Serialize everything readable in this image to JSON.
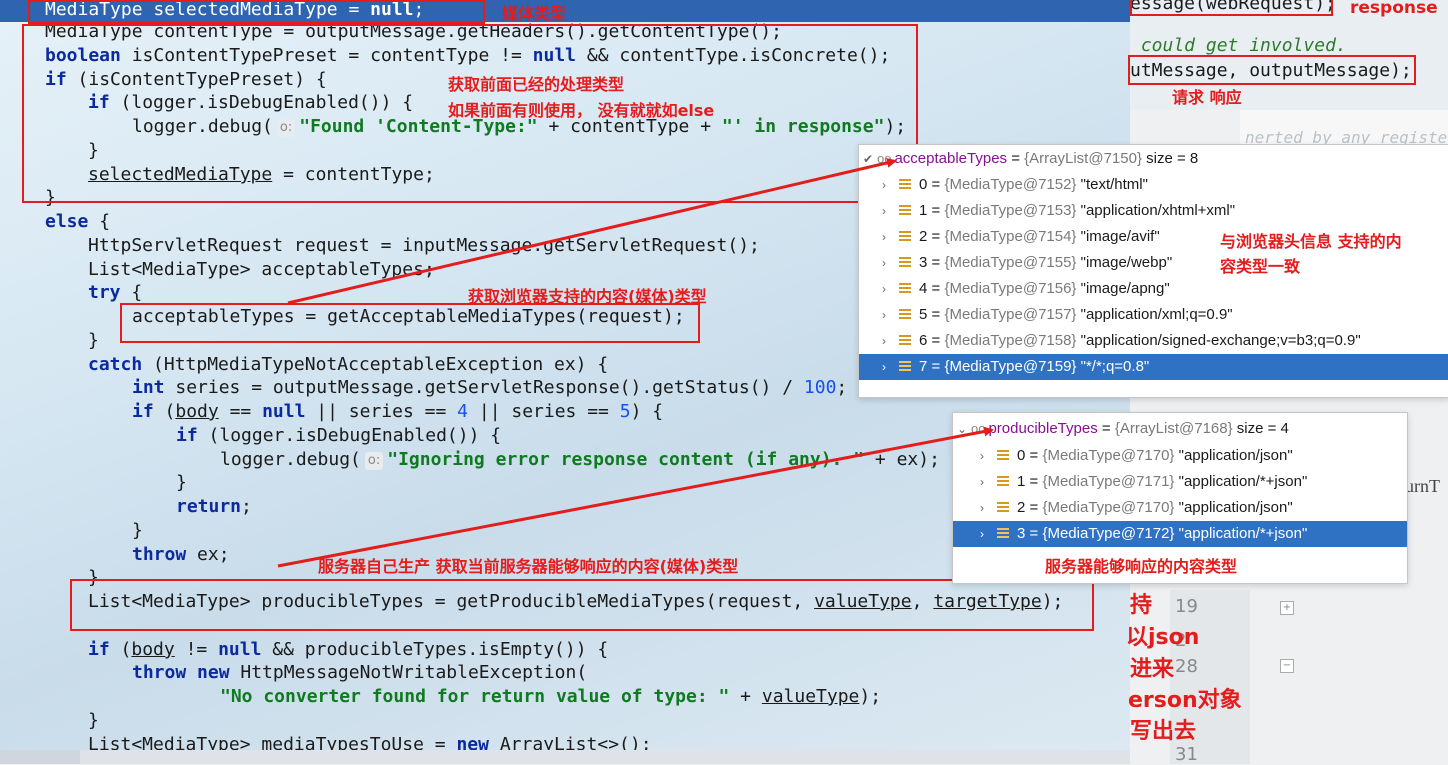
{
  "code": {
    "line1": {
      "t1": "MediaType",
      "t2": " selectedMediaType",
      "t3": " = ",
      "t4": "null",
      "t5": ";"
    },
    "line2": {
      "a": "MediaType contentType = outputMessage.getHeaders().getContentType();"
    },
    "line3": {
      "kw": "boolean",
      "rest": " isContentTypePreset = contentType != ",
      "kw2": "null",
      "rest2": " && contentType.isConcrete();"
    },
    "line4": {
      "kw": "if",
      "rest": " (isContentTypePreset) {"
    },
    "line5": {
      "kw": "if",
      "rest": " (logger.isDebugEnabled()) {"
    },
    "line6": {
      "a": "logger.debug(",
      "hint": "o:",
      "str": "\"Found 'Content-Type:\"",
      "b": " + contentType + ",
      "str2": "\"' in response\"",
      "c": ");"
    },
    "line7": {
      "a": "}"
    },
    "line8": {
      "a": "selectedMediaType",
      "b": " = contentType;"
    },
    "line9": {
      "a": "}"
    },
    "line10": {
      "kw": "else",
      "rest": " {"
    },
    "line11": {
      "a": "HttpServletRequest request = inputMessage.getServletRequest();"
    },
    "line12": {
      "a": "List<MediaType> acceptableTypes;"
    },
    "line13": {
      "kw": "try",
      "rest": " {"
    },
    "line14": {
      "a": "acceptableTypes = getAcceptableMediaTypes(request);"
    },
    "line15": {
      "a": "}"
    },
    "line16": {
      "kw": "catch",
      "rest": " (HttpMediaTypeNotAcceptableException ex) {"
    },
    "line17": {
      "kw": "int",
      "rest": " series = outputMessage.getServletResponse().getStatus() / ",
      "num": "100",
      "end": ";"
    },
    "line18": {
      "kw": "if",
      "a": " (",
      "u": "body",
      "b": " == ",
      "kw2": "null",
      "c": " || series == ",
      "n1": "4",
      "d": " || series == ",
      "n2": "5",
      "e": ") {"
    },
    "line19": {
      "kw": "if",
      "rest": " (logger.isDebugEnabled()) {"
    },
    "line20": {
      "a": "logger.debug(",
      "hint": "o:",
      "str": "\"Ignoring error response content (if any). \"",
      "b": " + ex);"
    },
    "line21": {
      "a": "}"
    },
    "line22": {
      "kw": "return",
      "rest": ";"
    },
    "line23": {
      "a": "}"
    },
    "line24": {
      "kw": "throw",
      "rest": " ex;"
    },
    "line25": {
      "a": "}"
    },
    "line26": {
      "a": "List<MediaType> producibleTypes = getProducibleMediaTypes(request, ",
      "u1": "valueType",
      "b": ", ",
      "u2": "targetType",
      "c": ");"
    },
    "line27": {
      "kw": "if",
      "a": " (",
      "u": "body",
      "b": " != ",
      "kw2": "null",
      "c": " && producibleTypes.isEmpty()) {"
    },
    "line28": {
      "kw": "throw",
      "kw2": " new",
      "rest": " HttpMessageNotWritableException("
    },
    "line29": {
      "str": "\"No converter found for return value of type: \"",
      "a": " + ",
      "u": "valueType",
      "b": ");"
    },
    "line30": {
      "a": "}"
    },
    "line31": {
      "a": "List<MediaType> mediaTypesToUse = ",
      "kw": "new",
      "b": " ArrayList<>();"
    }
  },
  "bg_code": {
    "line1": "essage(webRequest);",
    "line2": " could get involved.",
    "line3": "utMessage, outputMessage);",
    "faded": "nerted by any register",
    "returnT": "turnT",
    "gutter_nums": [
      "19",
      "28",
      "31"
    ],
    "gutter_partial": "2"
  },
  "annotations": {
    "media_type": "媒体类型",
    "response": "response",
    "get_prev": "获取前面已经的处理类型",
    "use_if": "如果前面有则使用， 没有就就如else",
    "request_response": "请求  响应",
    "browser_types": "获取浏览器支持的内容(媒体)类型",
    "match_header_1": "与浏览器头信息 支持的内",
    "match_header_2": "容类型一致",
    "server_produce": "服务器自己生产  获取当前服务器能够响应的内容(媒体)类型",
    "server_types": "服务器能够响应的内容类型",
    "side1": "持",
    "side2": "以json",
    "side3": "进来",
    "side4": "erson对象",
    "side5": "写出去"
  },
  "acceptable": {
    "name": "acceptableTypes",
    "ref": "{ArrayList@7150}",
    "size": "size = 8",
    "items": [
      {
        "idx": "0",
        "ref": "{MediaType@7152}",
        "val": "\"text/html\""
      },
      {
        "idx": "1",
        "ref": "{MediaType@7153}",
        "val": "\"application/xhtml+xml\""
      },
      {
        "idx": "2",
        "ref": "{MediaType@7154}",
        "val": "\"image/avif\""
      },
      {
        "idx": "3",
        "ref": "{MediaType@7155}",
        "val": "\"image/webp\""
      },
      {
        "idx": "4",
        "ref": "{MediaType@7156}",
        "val": "\"image/apng\""
      },
      {
        "idx": "5",
        "ref": "{MediaType@7157}",
        "val": "\"application/xml;q=0.9\""
      },
      {
        "idx": "6",
        "ref": "{MediaType@7158}",
        "val": "\"application/signed-exchange;v=b3;q=0.9\""
      },
      {
        "idx": "7",
        "ref": "{MediaType@7159}",
        "val": "\"*/*;q=0.8\""
      }
    ]
  },
  "producible": {
    "name": "producibleTypes",
    "ref": "{ArrayList@7168}",
    "size": "size = 4",
    "items": [
      {
        "idx": "0",
        "ref": "{MediaType@7170}",
        "val": "\"application/json\""
      },
      {
        "idx": "1",
        "ref": "{MediaType@7171}",
        "val": "\"application/*+json\""
      },
      {
        "idx": "2",
        "ref": "{MediaType@7170}",
        "val": "\"application/json\""
      },
      {
        "idx": "3",
        "ref": "{MediaType@7172}",
        "val": "\"application/*+json\""
      }
    ]
  }
}
